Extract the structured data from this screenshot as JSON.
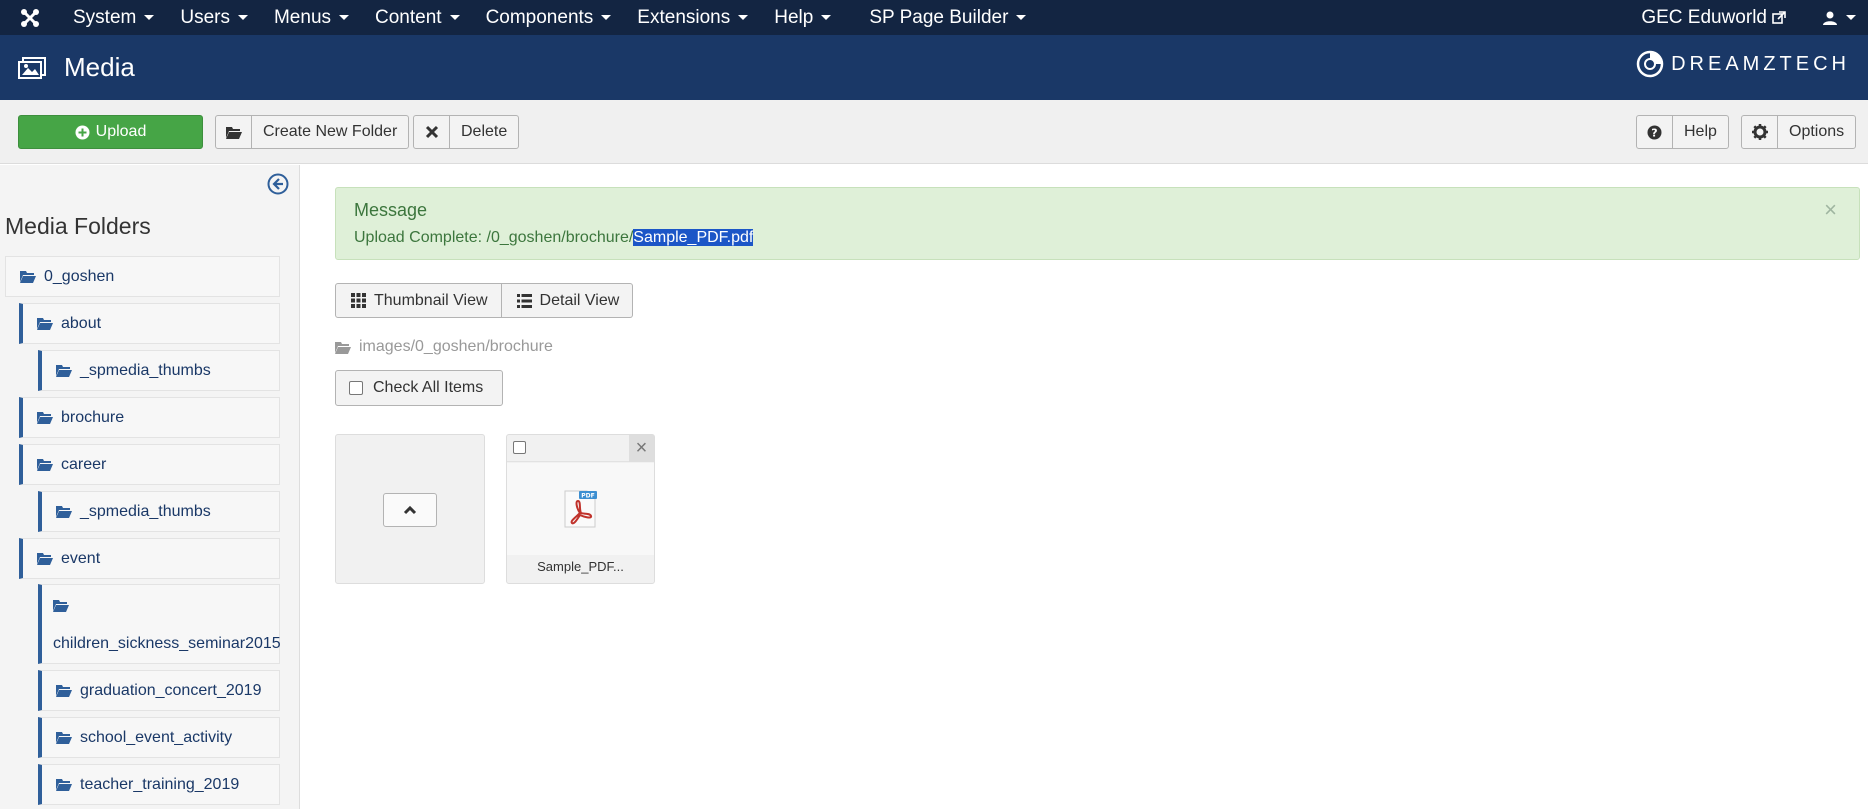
{
  "topnav": {
    "logo_icon": "joomla-icon",
    "menu": [
      {
        "label": "System"
      },
      {
        "label": "Users"
      },
      {
        "label": "Menus"
      },
      {
        "label": "Content"
      },
      {
        "label": "Components"
      },
      {
        "label": "Extensions"
      },
      {
        "label": "Help"
      },
      {
        "label": "SP Page Builder"
      }
    ],
    "site_label": "GEC Eduworld",
    "site_icon": "external-link-icon",
    "user_icon": "user-icon"
  },
  "header": {
    "title": "Media",
    "title_icon": "image-icon",
    "brand": "DREAMZTECH"
  },
  "toolbar": {
    "upload_label": "Upload",
    "new_folder_label": "Create New Folder",
    "delete_label": "Delete",
    "help_label": "Help",
    "options_label": "Options"
  },
  "sidebar": {
    "title": "Media Folders",
    "folders": [
      {
        "label": "0_goshen"
      },
      {
        "label": "about"
      },
      {
        "label": "_spmedia_thumbs"
      },
      {
        "label": "brochure"
      },
      {
        "label": "career"
      },
      {
        "label": "_spmedia_thumbs"
      },
      {
        "label": "event"
      },
      {
        "label": "children_sickness_seminar2015"
      },
      {
        "label": "graduation_concert_2019"
      },
      {
        "label": "school_event_activity"
      },
      {
        "label": "teacher_training_2019"
      }
    ]
  },
  "message": {
    "title": "Message",
    "prefix": "Upload Complete: /0_goshen/brochure/",
    "highlight": "Sample_PDF.pdf",
    "close": "×"
  },
  "views": {
    "thumbnail": "Thumbnail View",
    "detail": "Detail View"
  },
  "path": "images/0_goshen/brochure",
  "check_all": "Check All Items",
  "files": [
    {
      "name": "Sample_PDF...",
      "icon": "pdf-icon"
    }
  ],
  "colors": {
    "topnav": "#132542",
    "header": "#1a3867",
    "upload_btn": "#46a546",
    "alert_bg": "#dff0d8",
    "selection": "#1c56c7"
  }
}
